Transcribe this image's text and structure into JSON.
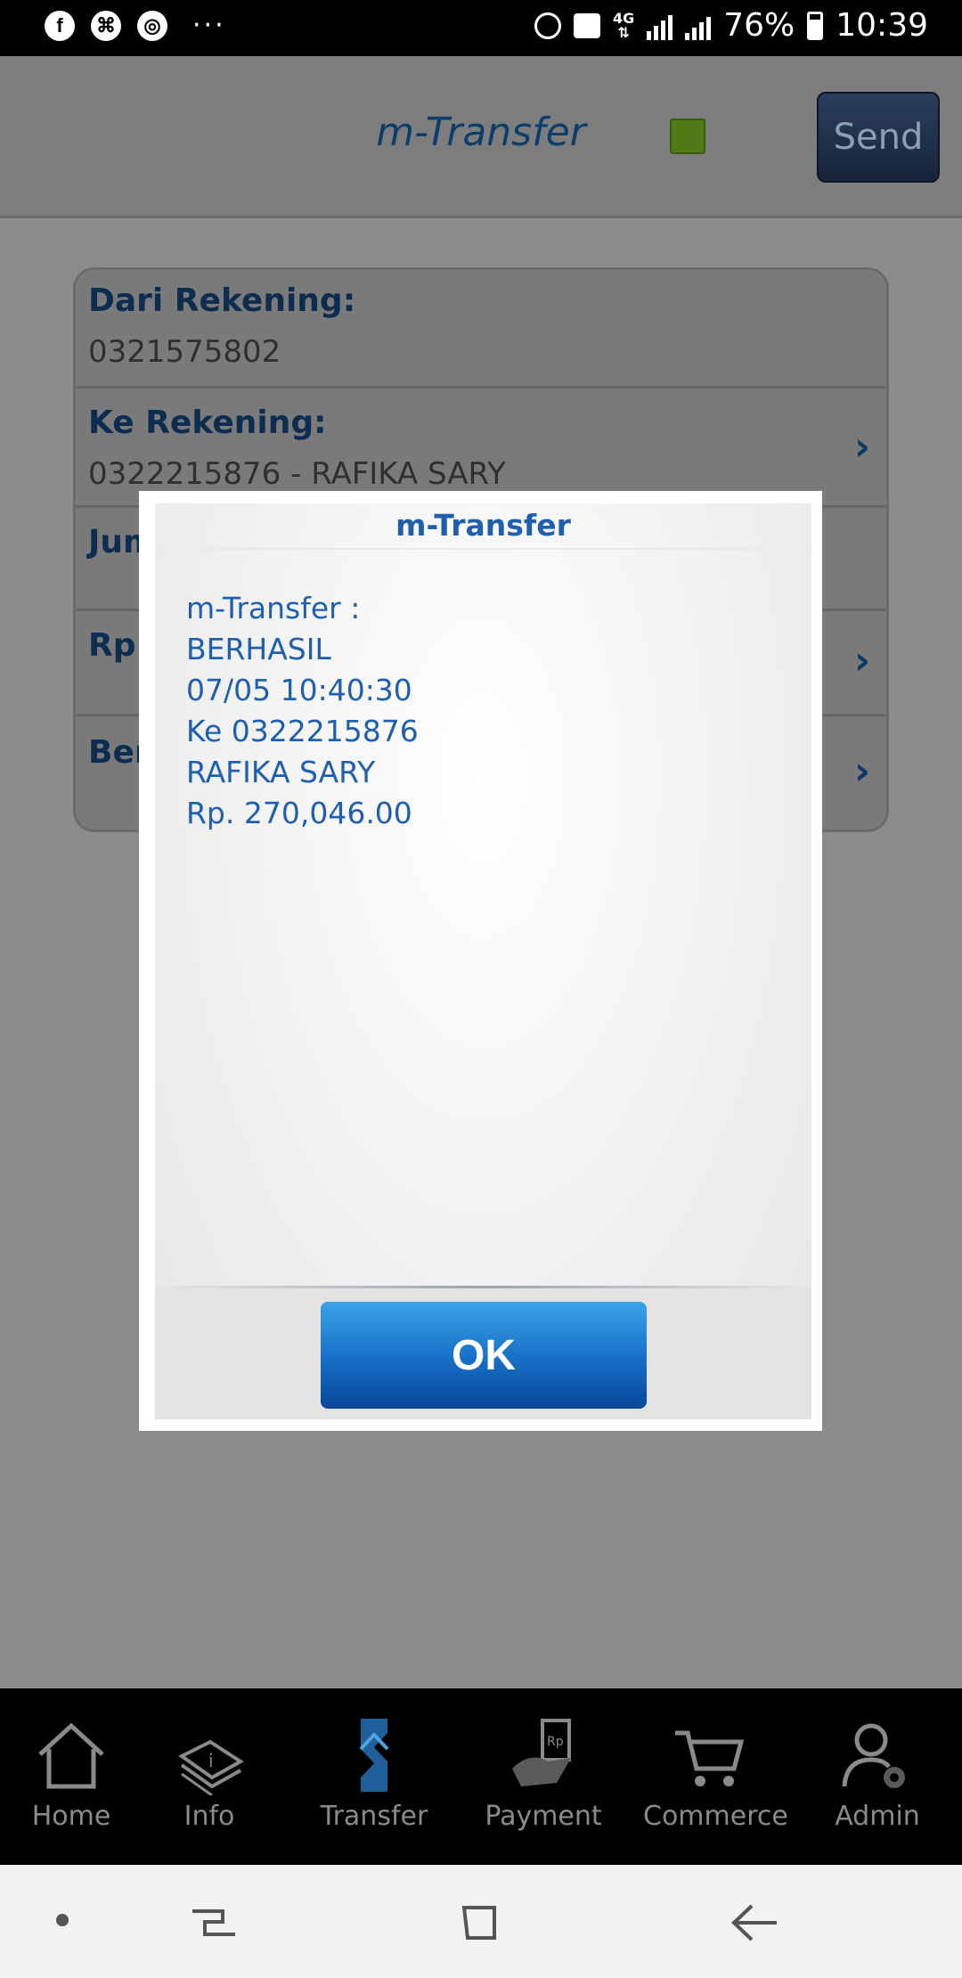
{
  "status_bar": {
    "left_icons": [
      "facebook-icon",
      "uc-browser-icon",
      "chrome-icon"
    ],
    "overflow": "···",
    "network": "4G",
    "battery": "76%",
    "time": "10:39"
  },
  "header": {
    "title": "m-Transfer",
    "send_label": "Send",
    "status_color": "#4f7a16"
  },
  "form": {
    "rows": [
      {
        "label": "Dari Rekening:",
        "value": "0321575802"
      },
      {
        "label": "Ke Rekening:",
        "value": "0322215876 - RAFIKA SARY"
      },
      {
        "label": "Jum",
        "value": ""
      },
      {
        "label": "Rp",
        "value": ""
      },
      {
        "label": "Ber",
        "value": ""
      }
    ]
  },
  "dialog": {
    "title": "m-Transfer",
    "lines": [
      "m-Transfer :",
      "BERHASIL",
      "07/05 10:40:30",
      "Ke 0322215876",
      "RAFIKA SARY",
      "Rp. 270,046.00"
    ],
    "ok_label": "OK"
  },
  "bottom_nav": {
    "items": [
      {
        "label": "Home",
        "icon": "home-icon"
      },
      {
        "label": "Info",
        "icon": "info-icon"
      },
      {
        "label": "Transfer",
        "icon": "transfer-icon"
      },
      {
        "label": "Payment",
        "icon": "payment-icon"
      },
      {
        "label": "Commerce",
        "icon": "cart-icon"
      },
      {
        "label": "Admin",
        "icon": "admin-icon"
      }
    ]
  },
  "colors": {
    "accent": "#1e5fb0",
    "header_title": "#0b3e6d",
    "ok_button": "#1973c9"
  }
}
